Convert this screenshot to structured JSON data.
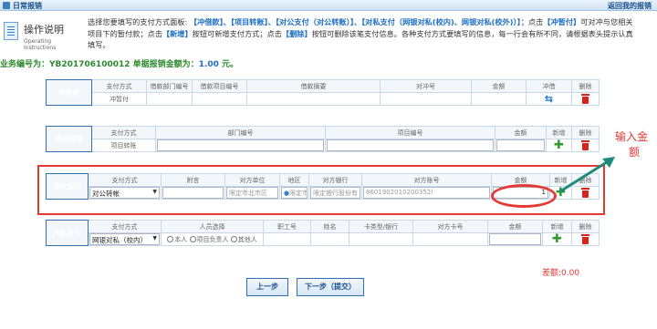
{
  "topbar": {
    "title": "日常报销",
    "back_label": "返回我的报销"
  },
  "ops": {
    "heading": "操作说明",
    "sub": "Operating Instructions"
  },
  "instructions": {
    "intro": "选择您要填写的支付方式面板: ",
    "opt1": "【冲借款】、【项目转账】、【对公支付（对公转账）】、【对私支付（网银对私(校内)、网银对私(校外)）】",
    "mid1": "；点击",
    "opt2": "【冲暂付】",
    "mid2": "可对冲与您相关项目下的暂付款；点击",
    "opt3": "【新增】",
    "mid3": "按钮可新增支付方式；点击",
    "opt4": "【删除】",
    "end": "按钮可删除该笔支付信息。各种支付方式要填写的信息，每一行会有所不同，请根据表头提示认真填写。"
  },
  "summary": {
    "biz_label": "业务编号为：",
    "biz_no": "YB201706100012",
    "amt_label": " 单据报销金额为：",
    "amount": "1.00",
    "unit": " 元。"
  },
  "chongjie": {
    "label": "冲借款",
    "headers": [
      "支付方式",
      "借款部门编号",
      "借款项目编号",
      "借款摘要",
      "对冲号",
      "金额",
      "冲借",
      "删除"
    ],
    "method": "冲暂付"
  },
  "xiangmu": {
    "label": "项目转账",
    "headers": [
      "支付方式",
      "部门编号",
      "项目编号",
      "金额",
      "新增",
      "删除"
    ],
    "method": "项目转账"
  },
  "duigong": {
    "label": "对公支付",
    "headers": [
      "支付方式",
      "附言",
      "对方单位",
      "地区",
      "对方银行",
      "对方账号",
      "金额",
      "新增",
      "删除"
    ],
    "method": "对公转帐",
    "unit_ph": "限定市北市区",
    "region_ph": "限定市",
    "bank_ph": "限定银行股份有",
    "account": "8601902010200352l",
    "amount_value": "1"
  },
  "duisi": {
    "label": "对私支付",
    "headers": [
      "支付方式",
      "人员选择",
      "职工号",
      "姓名",
      "卡类型/银行",
      "对方卡号",
      "金额",
      "新增",
      "删除"
    ],
    "method": "网银对私（校内）",
    "radio1": "本人",
    "radio2": "项目负责人",
    "radio3": "其他人"
  },
  "annotation": {
    "line1": "输入金",
    "line2": "额"
  },
  "diff": {
    "label": "差额:",
    "value": "0.00"
  },
  "buttons": {
    "prev": "上一步",
    "next": "下一步（提交）"
  },
  "colors": {
    "accent": "#2f6fb3",
    "highlight": "#e53935",
    "add": "#2e9a2e",
    "delete": "#d9241b",
    "link": "#1d6fc4"
  },
  "icons": {
    "add": "plus-icon",
    "delete": "trash-icon",
    "swap": "swap-arrows-icon",
    "help": "help-icon"
  }
}
